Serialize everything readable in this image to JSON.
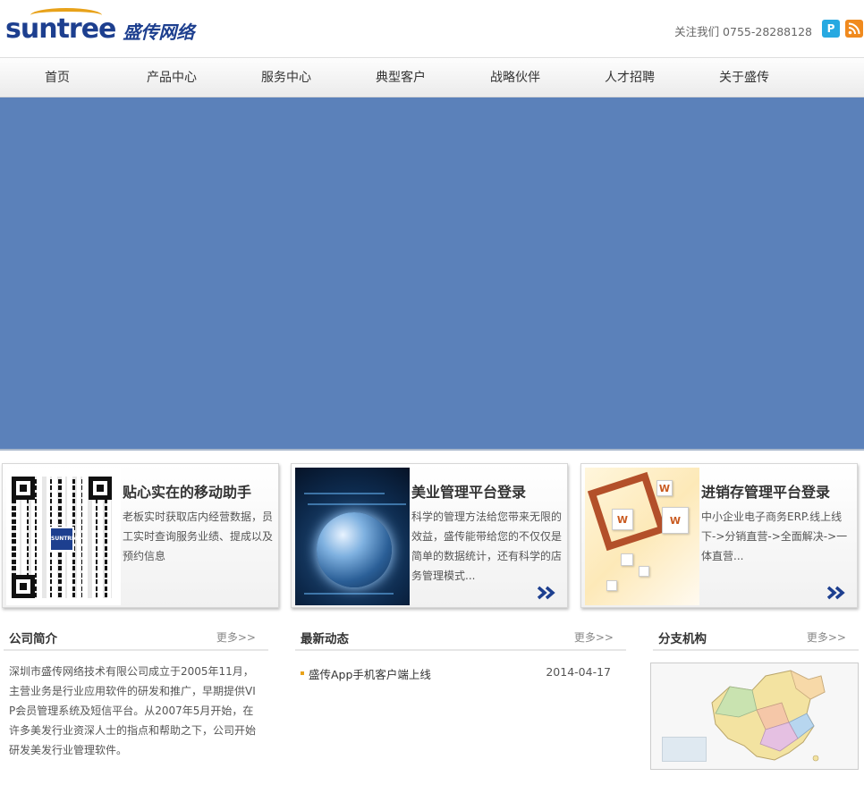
{
  "header": {
    "logo_en": "suntree",
    "logo_cn": "盛传网络",
    "contact": "关注我们 0755-28288128",
    "icons": [
      "p-icon",
      "rss-icon"
    ]
  },
  "nav": {
    "items": [
      "首页",
      "产品中心",
      "服务中心",
      "典型客户",
      "战略伙伴",
      "人才招聘",
      "关于盛传"
    ]
  },
  "banner": {
    "color": "#5b81ba"
  },
  "cards": [
    {
      "title": "贴心实在的移动助手",
      "desc": "老板实时获取店内经营数据，员工实时查询服务业绩、提成以及预约信息",
      "image": "qr-code",
      "qr_logo": "SUNTREE"
    },
    {
      "title": "美业管理平台登录",
      "desc": "科学的管理方法给您带来无限的效益，盛传能带给您的不仅仅是简单的数据统计，还有科学的店务管理模式...",
      "image": "globe-image"
    },
    {
      "title": "进销存管理平台登录",
      "desc": "中小企业电子商务ERP.线上线下->分销直营->全面解决->一体直营...",
      "image": "www-cubes-image"
    }
  ],
  "sections": {
    "intro": {
      "title": "公司简介",
      "more": "更多>>",
      "text": "深圳市盛传网络技术有限公司成立于2005年11月，主营业务是行业应用软件的研发和推广，早期提供VIP会员管理系统及短信平台。从2007年5月开始，在许多美发行业资深人士的指点和帮助之下，公司开始研发美发行业管理软件。"
    },
    "news": {
      "title": "最新动态",
      "more": "更多>>",
      "items": [
        {
          "title": "盛传App手机客户端上线",
          "date": "2014-04-17"
        }
      ]
    },
    "branches": {
      "title": "分支机构",
      "more": "更多>>",
      "image": "china-map"
    }
  },
  "colors": {
    "brand_blue": "#1d3f8f",
    "accent_orange": "#e8a21a",
    "banner": "#5b81ba"
  }
}
